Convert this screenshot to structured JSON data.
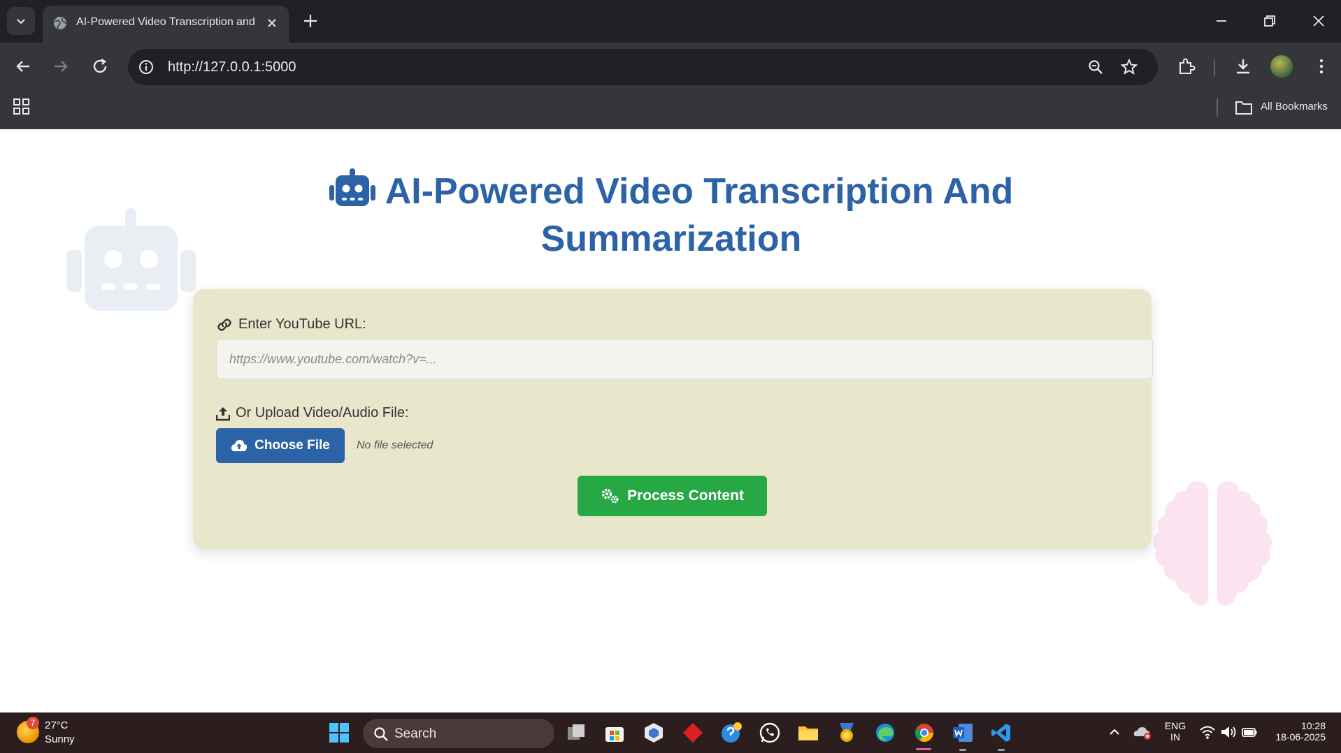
{
  "browser": {
    "tab_title": "AI-Powered Video Transcription and S",
    "url": "http://127.0.0.1:5000",
    "bookmarks_label": "All Bookmarks"
  },
  "page": {
    "heading": "AI-Powered Video Transcription And Summarization",
    "url_label": "Enter YouTube URL:",
    "url_placeholder": "https://www.youtube.com/watch?v=...",
    "url_value": "",
    "upload_label": "Or Upload Video/Audio File:",
    "choose_file_label": "Choose File",
    "no_file_text": "No file selected",
    "process_label": "Process Content"
  },
  "taskbar": {
    "weather_badge": "7",
    "temperature": "27°C",
    "condition": "Sunny",
    "search_label": "Search",
    "lang_line1": "ENG",
    "lang_line2": "IN",
    "time": "10:28",
    "date": "18-06-2025"
  },
  "colors": {
    "heading": "#2c62a6",
    "card_bg": "#e8e6cb",
    "choose_button": "#2c62a6",
    "process_button": "#28a745"
  }
}
